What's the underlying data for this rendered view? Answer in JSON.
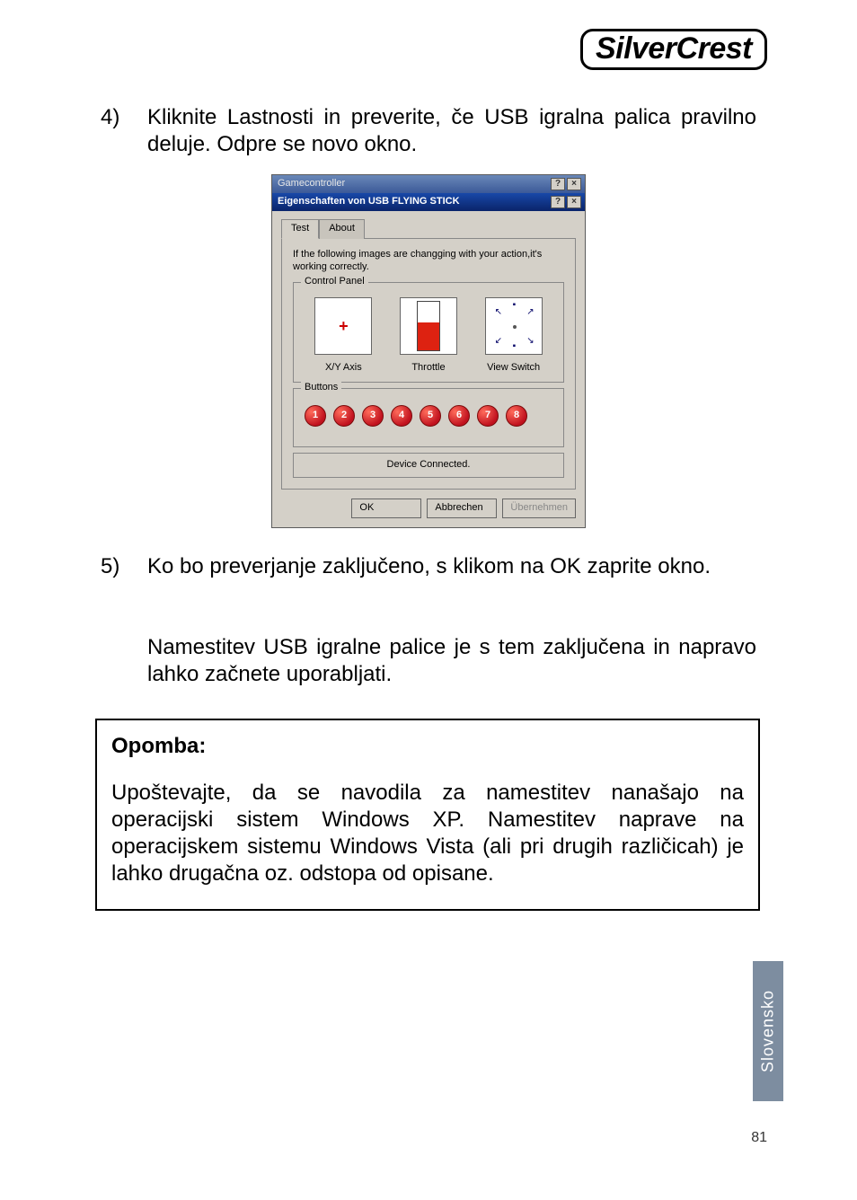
{
  "logo_text": "SilverCrest",
  "items": [
    {
      "marker": "4)",
      "body": "Kliknite Lastnosti in preverite, če USB igralna palica pravilno deluje. Odpre se novo okno.",
      "after_para": ""
    },
    {
      "marker": "5)",
      "body": "Ko bo preverjanje zaključeno, s klikom na OK zaprite okno.",
      "after_para": "Namestitev USB igralne palice je s tem zaključena in napravo lahko začnete uporabljati."
    }
  ],
  "note_title": "Opomba:",
  "note_body": "Upoštevajte, da se navodila za namestitev nanašajo na operacijski sistem Windows XP. Namestitev naprave na operacijskem sistemu Windows Vista (ali pri drugih različicah) je lahko drugačna oz. odstopa od opisane.",
  "side_tab": "Slovensko",
  "page_number": "81",
  "dialog": {
    "back_title": "Gamecontroller",
    "front_title": "Eigenschaften von USB FLYING STICK",
    "tab_test": "Test",
    "tab_about": "About",
    "instr": "If the following images are changging with your action,it's working correctly.",
    "group_control": "Control Panel",
    "lbl_xy": "X/Y Axis",
    "lbl_throttle": "Throttle",
    "lbl_view": "View Switch",
    "group_buttons": "Buttons",
    "buttons": [
      "1",
      "2",
      "3",
      "4",
      "5",
      "6",
      "7",
      "8"
    ],
    "status": "Device Connected.",
    "btn_ok": "OK",
    "btn_cancel": "Abbrechen",
    "btn_apply": "Übernehmen",
    "sys_help": "?",
    "sys_close": "×"
  },
  "chart_data": {
    "type": "table",
    "note": "embedded joystick-test dialog; no plotted dataset",
    "axes": {
      "xy": "centered crosshair",
      "throttle_pct_filled_from_bottom": 55
    },
    "buttons_lit": [
      1,
      2,
      3,
      4,
      5,
      6,
      7,
      8
    ]
  }
}
